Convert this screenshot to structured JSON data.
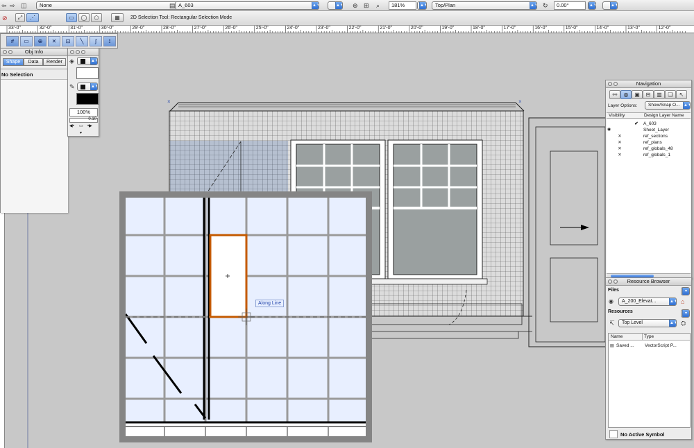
{
  "toolbar": {
    "class_select": "None",
    "layer_select": "A_603",
    "zoom_value": "181%",
    "view_select": "Top/Plan",
    "rotation_value": "0.00°"
  },
  "mode_bar": {
    "tool_label": "2D Selection Tool: Rectangular Selection Mode"
  },
  "ruler": {
    "labels": [
      "33'-0\"",
      "32'-0\"",
      "31'-0\"",
      "30'-0\"",
      "29'-0\"",
      "28'-0\"",
      "27'-0\"",
      "26'-0\"",
      "25'-0\"",
      "24'-0\"",
      "23'-0\"",
      "22'-0\"",
      "21'-0\"",
      "20'-0\"",
      "19'-0\"",
      "18'-0\"",
      "17'-0\"",
      "16'-0\"",
      "15'-0\"",
      "14'-0\"",
      "13'-0\"",
      "12'-0\""
    ]
  },
  "obj_info": {
    "title": "Obj Info",
    "tabs": [
      "Shape",
      "Data",
      "Render"
    ],
    "active_tab": "Shape",
    "status": "No Selection"
  },
  "attributes": {
    "opacity": "100%",
    "line_weight": "0.10"
  },
  "drawing": {
    "snap_label": "Along Line"
  },
  "navigation": {
    "title": "Navigation",
    "layer_options_label": "Layer Options:",
    "layer_options_value": "Show/Snap O...",
    "col_visibility": "Visibility",
    "col_name": "Design Layer Name",
    "layers": [
      {
        "name": "A_603",
        "visibility": "",
        "active": "✔"
      },
      {
        "name": "Sheet_Layer",
        "visibility": "",
        "active": ""
      },
      {
        "name": "ref_sections",
        "visibility": "✕",
        "active": ""
      },
      {
        "name": "ref_plans",
        "visibility": "✕",
        "active": ""
      },
      {
        "name": "ref_globals_48",
        "visibility": "✕",
        "active": ""
      },
      {
        "name": "ref_globals_1",
        "visibility": "✕",
        "active": ""
      }
    ]
  },
  "resource_browser": {
    "title": "Resource Browser",
    "files_label": "Files",
    "file_value": "A_200_Elevat...",
    "resources_label": "Resources",
    "resources_value": "Top Level",
    "col_name": "Name",
    "col_type": "Type",
    "items": [
      {
        "name": "Saved ...",
        "type": "VectorScript P..."
      }
    ],
    "footer": "No Active Symbol"
  },
  "colors": {
    "selection_accent": "#c45a00",
    "select_arrow": "#3a78dc"
  }
}
